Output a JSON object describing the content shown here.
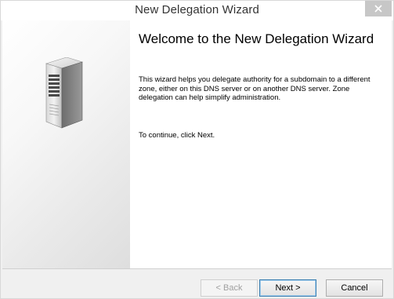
{
  "window": {
    "title": "New Delegation Wizard",
    "close_icon": "close-icon"
  },
  "side_panel": {
    "illustration": "server-tower-icon"
  },
  "main": {
    "heading": "Welcome to the New Delegation Wizard",
    "description": "This wizard helps you delegate authority for a subdomain to a different zone, either on this DNS server or on another DNS server. Zone delegation can help simplify administration.",
    "continue_text": "To continue, click Next."
  },
  "footer": {
    "back_label": "< Back",
    "next_label": "Next >",
    "cancel_label": "Cancel"
  },
  "colors": {
    "default_button_border": "#3c7fb1",
    "disabled_text": "#a0a0a0"
  }
}
